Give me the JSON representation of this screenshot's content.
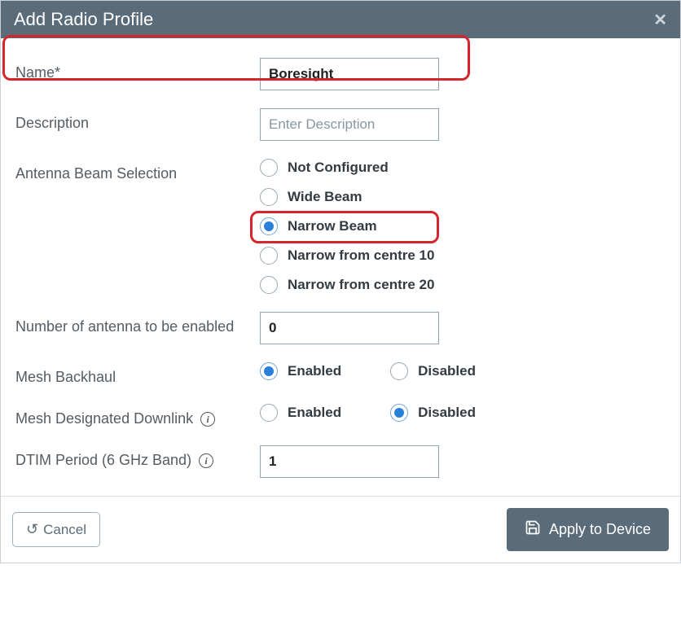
{
  "dialog": {
    "title": "Add Radio Profile"
  },
  "fields": {
    "name": {
      "label": "Name*",
      "value": "Boresight"
    },
    "description": {
      "label": "Description",
      "placeholder": "Enter Description",
      "value": ""
    },
    "antennaBeam": {
      "label": "Antenna Beam Selection",
      "options": [
        {
          "label": "Not Configured",
          "checked": false
        },
        {
          "label": "Wide Beam",
          "checked": false
        },
        {
          "label": "Narrow Beam",
          "checked": true
        },
        {
          "label": "Narrow from centre 10",
          "checked": false
        },
        {
          "label": "Narrow from centre 20",
          "checked": false
        }
      ]
    },
    "numAntenna": {
      "label": "Number of antenna to be enabled",
      "value": "0"
    },
    "meshBackhaul": {
      "label": "Mesh Backhaul",
      "enabledLabel": "Enabled",
      "disabledLabel": "Disabled",
      "value": "Enabled"
    },
    "meshDownlink": {
      "label": "Mesh Designated Downlink",
      "enabledLabel": "Enabled",
      "disabledLabel": "Disabled",
      "value": "Disabled"
    },
    "dtim": {
      "label": "DTIM Period (6 GHz Band)",
      "value": "1"
    }
  },
  "footer": {
    "cancel": "Cancel",
    "apply": "Apply to Device"
  }
}
